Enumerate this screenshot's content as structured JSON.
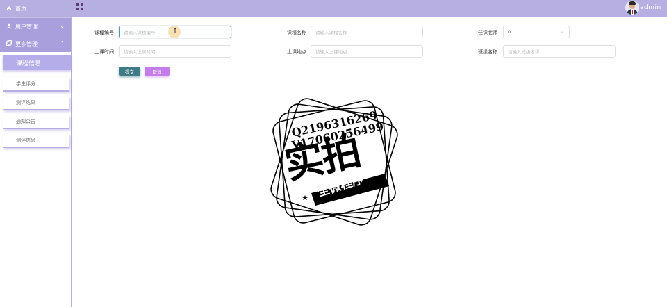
{
  "sidebar": {
    "home": {
      "label": "首页",
      "icon": "home-icon"
    },
    "groups": [
      {
        "label": "用户管理",
        "icon": "user-icon",
        "expanded": false
      },
      {
        "label": "更多管理",
        "icon": "copy-icon",
        "expanded": true
      }
    ],
    "active_item": "课程信息",
    "items": [
      "学生评分",
      "测评结果",
      "通知公告",
      "测评信息"
    ]
  },
  "header": {
    "menu_icon": "grid-icon",
    "user_name": "admin"
  },
  "form": {
    "course_no": {
      "label": "课程编号",
      "placeholder": "请输入课程编号"
    },
    "course_name": {
      "label": "课程名称",
      "placeholder": "请输入课程名称"
    },
    "teacher": {
      "label": "任课老师",
      "value": "0"
    },
    "class_time": {
      "label": "上课时间",
      "placeholder": "请输入上课时间"
    },
    "class_location": {
      "label": "上课地点",
      "placeholder": "请输入上课地点"
    },
    "class_name": {
      "label": "班级名称",
      "placeholder": "请输入班级名称"
    },
    "submit_label": "提交",
    "cancel_label": "取消"
  },
  "watermark": {
    "line1": "Q2196316269",
    "line2": "V17060256499",
    "big": "实拍",
    "banner": "全微程序"
  },
  "colors": {
    "header_bg": "#b7aee2",
    "submit": "#3f7b86",
    "cancel": "#c37ce8"
  }
}
